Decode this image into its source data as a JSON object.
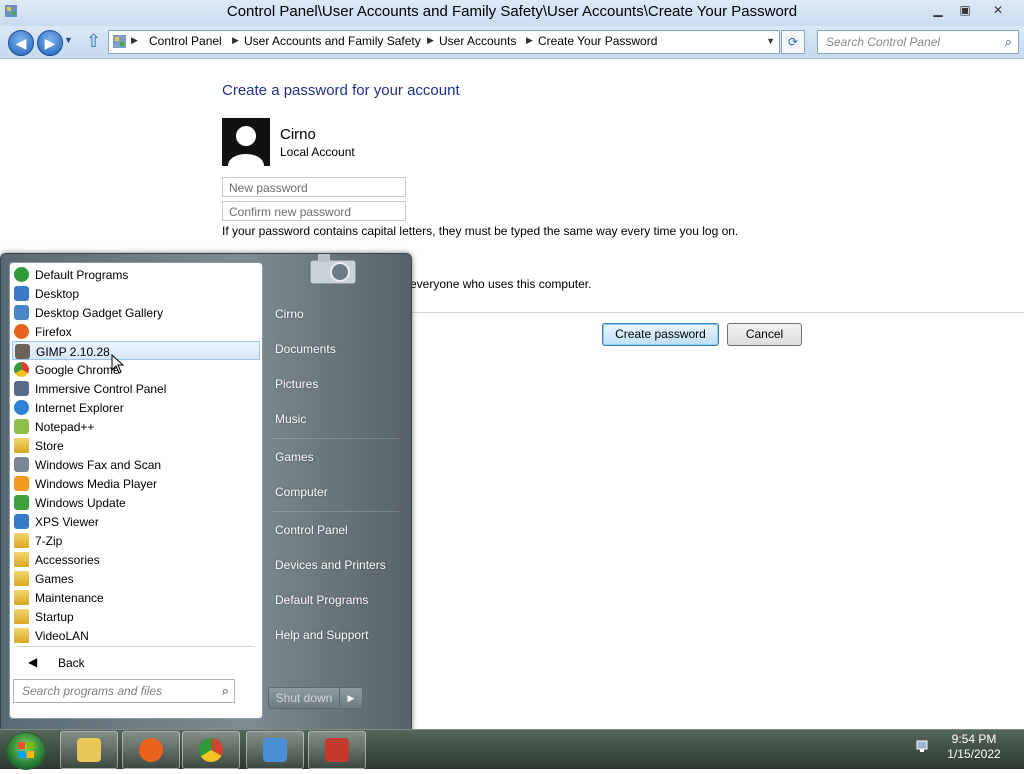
{
  "window": {
    "title": "Control Panel\\User Accounts and Family Safety\\User Accounts\\Create Your Password",
    "minimize_icon": "minimize-icon",
    "maximize_icon": "restore-icon",
    "close_icon": "close-icon"
  },
  "address_bar": {
    "crumbs": [
      "Control Panel",
      "User Accounts and Family Safety",
      "User Accounts",
      "Create Your Password"
    ]
  },
  "search": {
    "placeholder": "Search Control Panel"
  },
  "main": {
    "heading": "Create a password for your account",
    "user_name": "Cirno",
    "user_type": "Local Account",
    "new_password_placeholder": "New password",
    "confirm_password_placeholder": "Confirm new password",
    "note": "If your password contains capital letters, they must be typed the same way every time you log on.",
    "note2": "everyone who uses this computer.",
    "create_button": "Create password",
    "cancel_button": "Cancel"
  },
  "start_menu": {
    "programs": [
      {
        "label": "Default Programs",
        "icon": "default-programs-icon",
        "color": "#2e9a3a"
      },
      {
        "label": "Desktop",
        "icon": "desktop-icon",
        "color": "#3a78c8"
      },
      {
        "label": "Desktop Gadget Gallery",
        "icon": "gadget-icon",
        "color": "#4a86c8"
      },
      {
        "label": "Firefox",
        "icon": "firefox-icon",
        "color": "#e8631e"
      },
      {
        "label": "GIMP 2.10.28",
        "icon": "gimp-icon",
        "color": "#6d6257"
      },
      {
        "label": "Google Chrome",
        "icon": "chrome-icon",
        "color": "#d8412f"
      },
      {
        "label": "Immersive Control Panel",
        "icon": "gear-icon",
        "color": "#5a6b8a"
      },
      {
        "label": "Internet Explorer",
        "icon": "ie-icon",
        "color": "#2f7fd3"
      },
      {
        "label": "Notepad++",
        "icon": "notepad-icon",
        "color": "#8fbf4a"
      },
      {
        "label": "Store",
        "icon": "folder-icon",
        "color": "#e2b63c"
      },
      {
        "label": "Windows Fax and Scan",
        "icon": "fax-icon",
        "color": "#7b8794"
      },
      {
        "label": "Windows Media Player",
        "icon": "media-player-icon",
        "color": "#f39a1f"
      },
      {
        "label": "Windows Update",
        "icon": "update-icon",
        "color": "#3e9f3e"
      },
      {
        "label": "XPS Viewer",
        "icon": "xps-icon",
        "color": "#3a7bc8"
      },
      {
        "label": "7-Zip",
        "icon": "folder-icon",
        "color": "#e2b63c"
      },
      {
        "label": "Accessories",
        "icon": "folder-icon",
        "color": "#e2b63c"
      },
      {
        "label": "Games",
        "icon": "folder-icon",
        "color": "#e2b63c"
      },
      {
        "label": "Maintenance",
        "icon": "folder-icon",
        "color": "#e2b63c"
      },
      {
        "label": "Startup",
        "icon": "folder-icon",
        "color": "#e2b63c"
      },
      {
        "label": "VideoLAN",
        "icon": "folder-icon",
        "color": "#e2b63c"
      }
    ],
    "selected_program": "GIMP 2.10.28",
    "back_label": "Back",
    "search_placeholder": "Search programs and files",
    "right_items": [
      "Cirno",
      "Documents",
      "Pictures",
      "Music",
      "Games",
      "Computer",
      "Control Panel",
      "Devices and Printers",
      "Default Programs",
      "Help and Support"
    ],
    "shutdown_label": "Shut down"
  },
  "taskbar": {
    "pinned": [
      {
        "name": "explorer-icon",
        "color": "#e9c85a"
      },
      {
        "name": "firefox-icon",
        "color": "#e8631e"
      },
      {
        "name": "chrome-icon",
        "color": "#d8412f"
      },
      {
        "name": "control-panel-icon",
        "color": "#4a8fd8"
      },
      {
        "name": "toolbox-icon",
        "color": "#c53a2e"
      }
    ],
    "time": "9:54 PM",
    "date": "1/15/2022"
  },
  "colors": {
    "heading": "#1e3287",
    "start_menu_bg": "#6f7e84",
    "taskbar_bg": "#3a4a3f"
  }
}
